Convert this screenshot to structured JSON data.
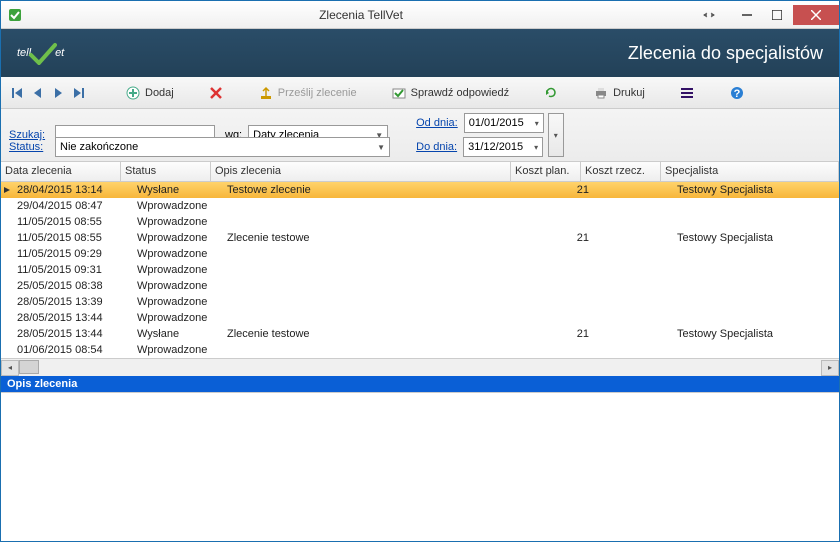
{
  "window": {
    "title": "Zlecenia TellVet"
  },
  "brand": {
    "logo_text": "tellVet",
    "subtitle": "Zlecenia do specjalistów"
  },
  "toolbar": {
    "add_label": "Dodaj",
    "send_label": "Prześlij zlecenie",
    "check_label": "Sprawdź odpowiedź",
    "print_label": "Drukuj"
  },
  "filters": {
    "search_label": "Szukaj:",
    "search_value": "",
    "wg_label": "wg:",
    "wg_value": "Daty zlecenia",
    "status_label": "Status:",
    "status_value": "Nie zakończone",
    "from_label": "Od dnia:",
    "from_value": "01/01/2015",
    "to_label": "Do dnia:",
    "to_value": "31/12/2015"
  },
  "columns": {
    "date": "Data zlecenia",
    "status": "Status",
    "desc": "Opis zlecenia",
    "kp": "Koszt plan.",
    "kr": "Koszt rzecz.",
    "spec": "Specjalista"
  },
  "rows": [
    {
      "date": "28/04/2015 13:14",
      "status": "Wysłane",
      "desc": "Testowe zlecenie",
      "kp": "21",
      "kr": "",
      "spec": "Testowy Specjalista",
      "sel": true
    },
    {
      "date": "29/04/2015 08:47",
      "status": "Wprowadzone",
      "desc": "",
      "kp": "",
      "kr": "",
      "spec": ""
    },
    {
      "date": "11/05/2015 08:55",
      "status": "Wprowadzone",
      "desc": "",
      "kp": "",
      "kr": "",
      "spec": ""
    },
    {
      "date": "11/05/2015 08:55",
      "status": "Wprowadzone",
      "desc": "Zlecenie testowe",
      "kp": "21",
      "kr": "",
      "spec": "Testowy Specjalista"
    },
    {
      "date": "11/05/2015 09:29",
      "status": "Wprowadzone",
      "desc": "",
      "kp": "",
      "kr": "",
      "spec": ""
    },
    {
      "date": "11/05/2015 09:31",
      "status": "Wprowadzone",
      "desc": "",
      "kp": "",
      "kr": "",
      "spec": ""
    },
    {
      "date": "25/05/2015 08:38",
      "status": "Wprowadzone",
      "desc": "",
      "kp": "",
      "kr": "",
      "spec": ""
    },
    {
      "date": "28/05/2015 13:39",
      "status": "Wprowadzone",
      "desc": "",
      "kp": "",
      "kr": "",
      "spec": ""
    },
    {
      "date": "28/05/2015 13:44",
      "status": "Wprowadzone",
      "desc": "",
      "kp": "",
      "kr": "",
      "spec": ""
    },
    {
      "date": "28/05/2015 13:44",
      "status": "Wysłane",
      "desc": "Zlecenie testowe",
      "kp": "21",
      "kr": "",
      "spec": "Testowy Specjalista"
    },
    {
      "date": "01/06/2015 08:54",
      "status": "Wprowadzone",
      "desc": "",
      "kp": "",
      "kr": "",
      "spec": ""
    }
  ],
  "detail": {
    "title": "Opis zlecenia"
  },
  "colors": {
    "brand_bg": "#2a4d68",
    "selection": "#f7b63a",
    "link": "#0645ad",
    "section_title_bg": "#0a5fd6"
  }
}
